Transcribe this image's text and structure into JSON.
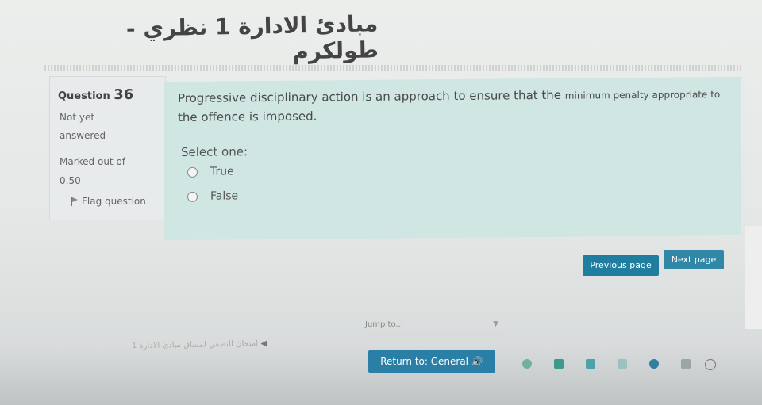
{
  "course": {
    "title": "مبادئ الادارة 1 نظري - طولكرم"
  },
  "question_info": {
    "label": "Question",
    "number": "36",
    "status_line1": "Not yet",
    "status_line2": "answered",
    "marks_line1": "Marked out of",
    "marks_line2": "0.50",
    "flag_label": "Flag question"
  },
  "question": {
    "text_part1": "Progressive disciplinary action is an approach to ensure that the ",
    "text_small": "minimum penalty appropriate to",
    "text_line2": "the offence is imposed.",
    "prompt": "Select one:",
    "options": [
      {
        "label": "True"
      },
      {
        "label": "False"
      }
    ]
  },
  "navigation": {
    "previous_label": "Previous page",
    "next_label": "Next page",
    "jump_placeholder": "Jump to...",
    "previous_activity": "امتحان النصفي لمساق مبادئ الادارة 1",
    "return_label": "Return to: General"
  },
  "colors": {
    "question_bg": "#cfe6e3",
    "button_bg": "#1f7ea0",
    "info_bg": "#e8ebeb"
  }
}
